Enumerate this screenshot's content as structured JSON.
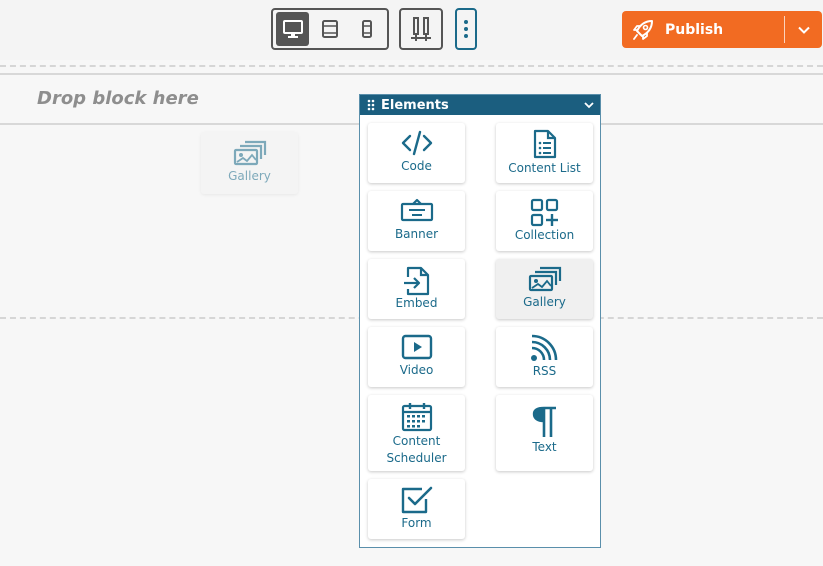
{
  "toolbar": {
    "devices": [
      {
        "name": "desktop-icon",
        "active": true
      },
      {
        "name": "tablet-icon",
        "active": false
      },
      {
        "name": "mobile-icon",
        "active": false
      }
    ],
    "layout_icon": "column-layout-icon",
    "more_icon": "vertical-dots-icon",
    "publish_label": "Publish",
    "publish_icon": "rocket-icon",
    "publish_color": "#f26b22"
  },
  "canvas": {
    "drop_text": "Drop block here",
    "dragging_tile_label": "Gallery"
  },
  "panel": {
    "title": "Elements",
    "header_color": "#1b5e7f",
    "items": [
      {
        "label": "Code",
        "icon": "code-icon"
      },
      {
        "label": "Content List",
        "icon": "document-list-icon"
      },
      {
        "label": "Banner",
        "icon": "banner-icon"
      },
      {
        "label": "Collection",
        "icon": "collection-icon"
      },
      {
        "label": "Embed",
        "icon": "embed-file-icon"
      },
      {
        "label": "Gallery",
        "icon": "gallery-icon"
      },
      {
        "label": "Video",
        "icon": "video-play-icon"
      },
      {
        "label": "RSS",
        "icon": "rss-icon"
      },
      {
        "label": "Content",
        "label_line2": "Scheduler",
        "icon": "calendar-icon"
      },
      {
        "label": "Text",
        "icon": "pilcrow-icon"
      },
      {
        "label": "Form",
        "icon": "form-checkbox-icon"
      }
    ]
  }
}
